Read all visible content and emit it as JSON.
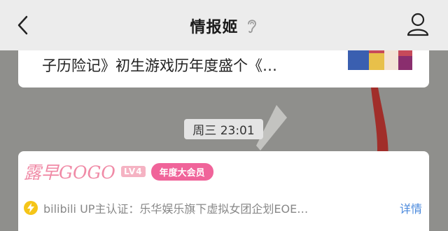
{
  "nav": {
    "title": "情报姬",
    "back_icon": "chevron-left-icon",
    "ear_icon": "ear-icon",
    "profile_icon": "person-icon"
  },
  "prev_article": {
    "snippet": "子历险记》初生游戏历年度盛个《…"
  },
  "timestamp": "周三 23:01",
  "profile": {
    "name": "露早GOGO",
    "level": "LV4",
    "vip_label": "年度大会员",
    "verify_text": "bilibili UP主认证：乐华娱乐旗下虚拟女团企划EOE…",
    "detail_label": "详情",
    "verify_icon": "lightning-bolt-icon"
  },
  "colors": {
    "nav_bg": "#ececec",
    "page_bg": "#8f8f8c",
    "name_pink": "#f08aa6",
    "vip_pink": "#f0649a",
    "link_blue": "#4a89dc",
    "bolt_yellow": "#f5c518"
  }
}
